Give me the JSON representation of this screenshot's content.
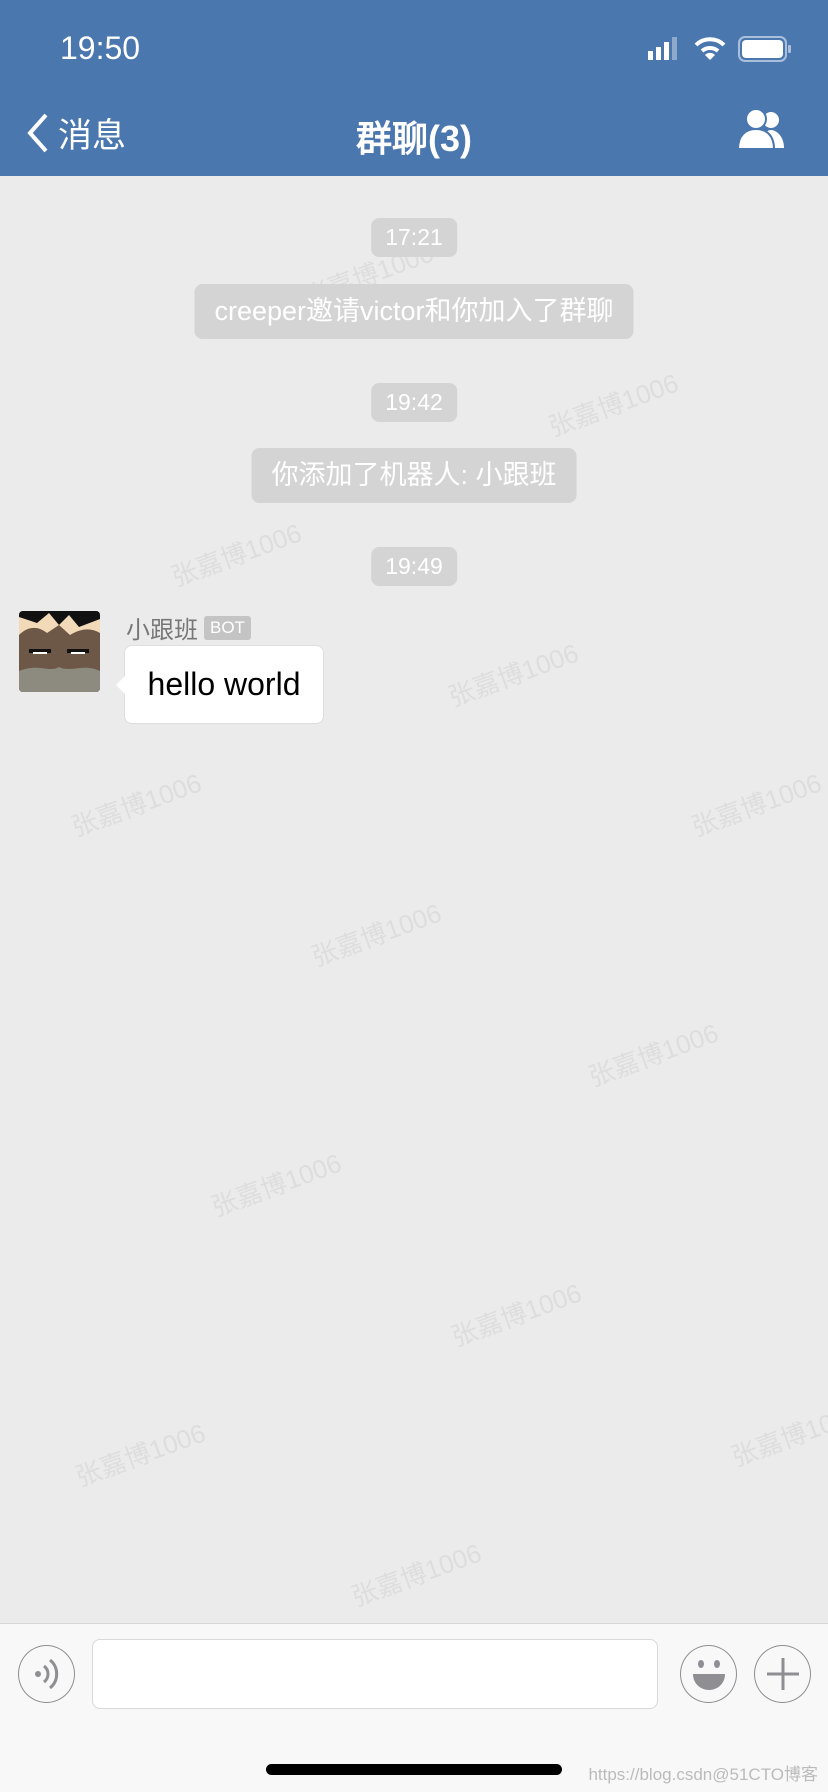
{
  "status_bar": {
    "time": "19:50"
  },
  "nav": {
    "back_label": "消息",
    "title": "群聊(3)"
  },
  "messages": [
    {
      "type": "timestamp",
      "text": "17:21"
    },
    {
      "type": "system",
      "text": "creeper邀请victor和你加入了群聊"
    },
    {
      "type": "timestamp",
      "text": "19:42"
    },
    {
      "type": "system",
      "text": "你添加了机器人: 小跟班"
    },
    {
      "type": "timestamp",
      "text": "19:49"
    },
    {
      "type": "message",
      "sender": "小跟班",
      "badge": "BOT",
      "text": "hello world"
    }
  ],
  "input_bar": {
    "placeholder": ""
  },
  "watermark": "张嘉博1006",
  "credit": "https://blog.csdn@51CTO博客",
  "colors": {
    "header": "#4a77ae",
    "background": "#ebebeb"
  }
}
